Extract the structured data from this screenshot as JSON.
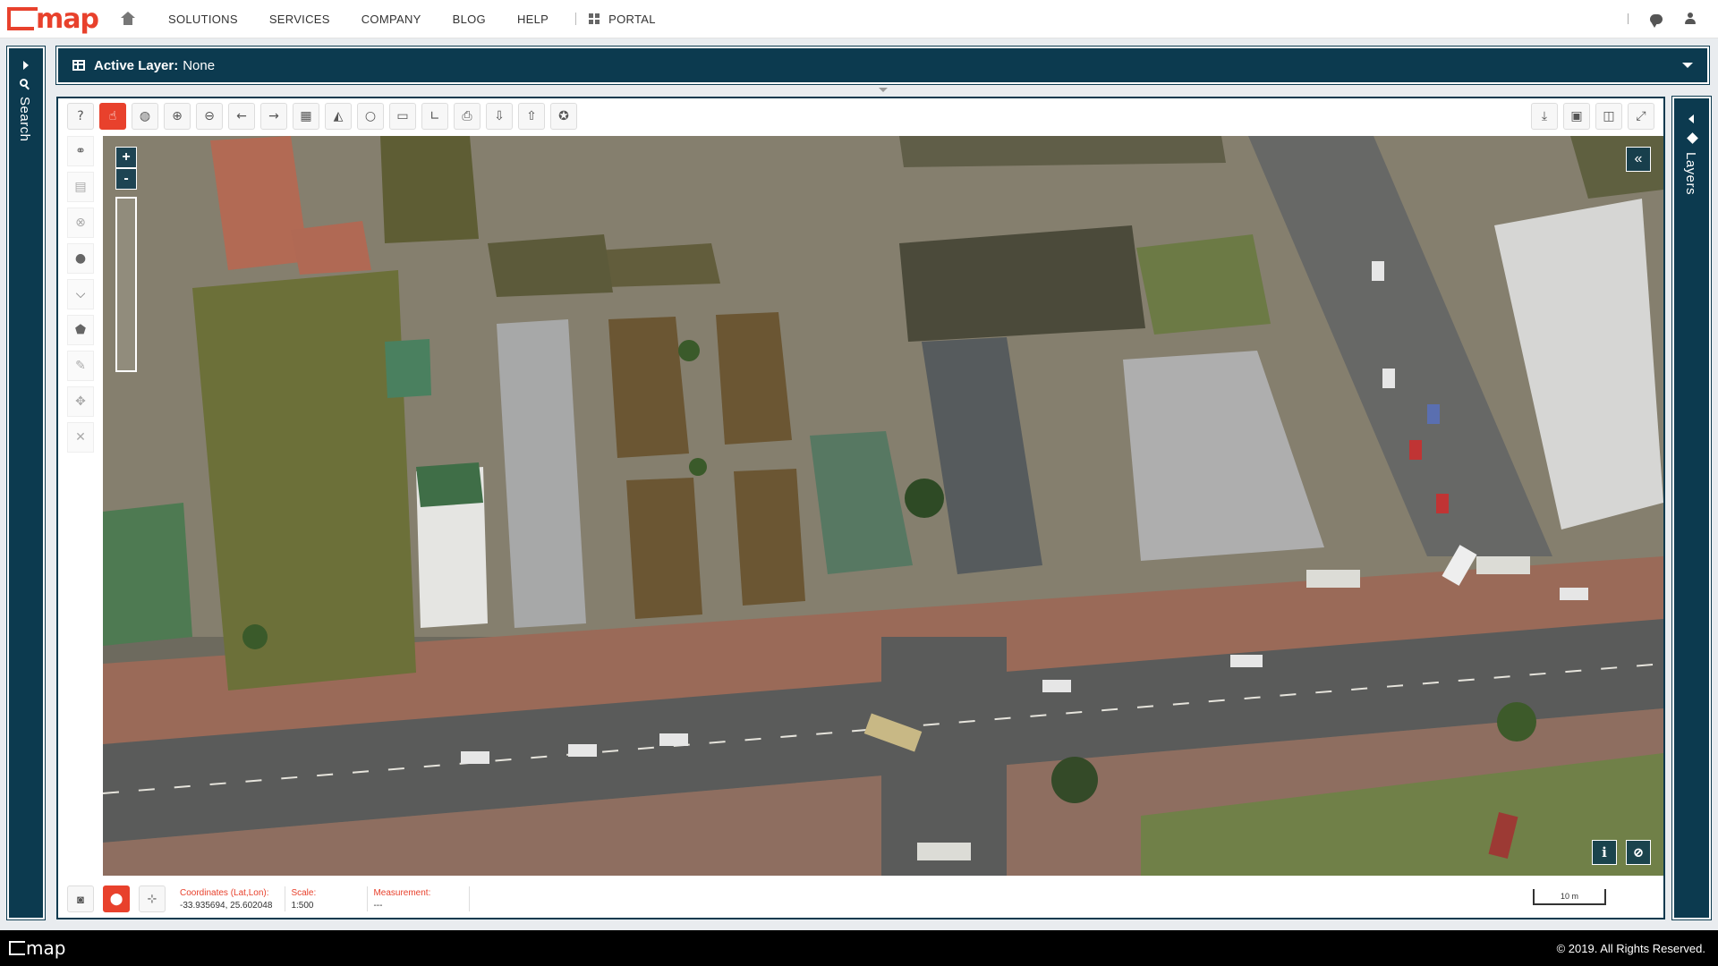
{
  "brand": {
    "name": "map"
  },
  "nav": {
    "items": [
      "SOLUTIONS",
      "SERVICES",
      "COMPANY",
      "BLOG",
      "HELP"
    ],
    "portal": "PORTAL"
  },
  "left_panel": {
    "label": "Search"
  },
  "right_panel": {
    "label": "Layers"
  },
  "layer_bar": {
    "label": "Active Layer:",
    "value": "None"
  },
  "map": {
    "zoom_in": "+",
    "zoom_out": "-",
    "collapse": "«",
    "info": "i",
    "attach": "⊘"
  },
  "status": {
    "coordinates_label": "Coordinates (Lat,Lon):",
    "coordinates_value": "-33.935694, 25.602048",
    "scale_label": "Scale:",
    "scale_value": "1:500",
    "measurement_label": "Measurement:",
    "measurement_value": "---",
    "scalebar": "10 m"
  },
  "footer": {
    "logo": "map",
    "copyright": "© 2019. All Rights Reserved."
  },
  "colors": {
    "accent": "#e8412c",
    "panel": "#0c3a4f"
  }
}
